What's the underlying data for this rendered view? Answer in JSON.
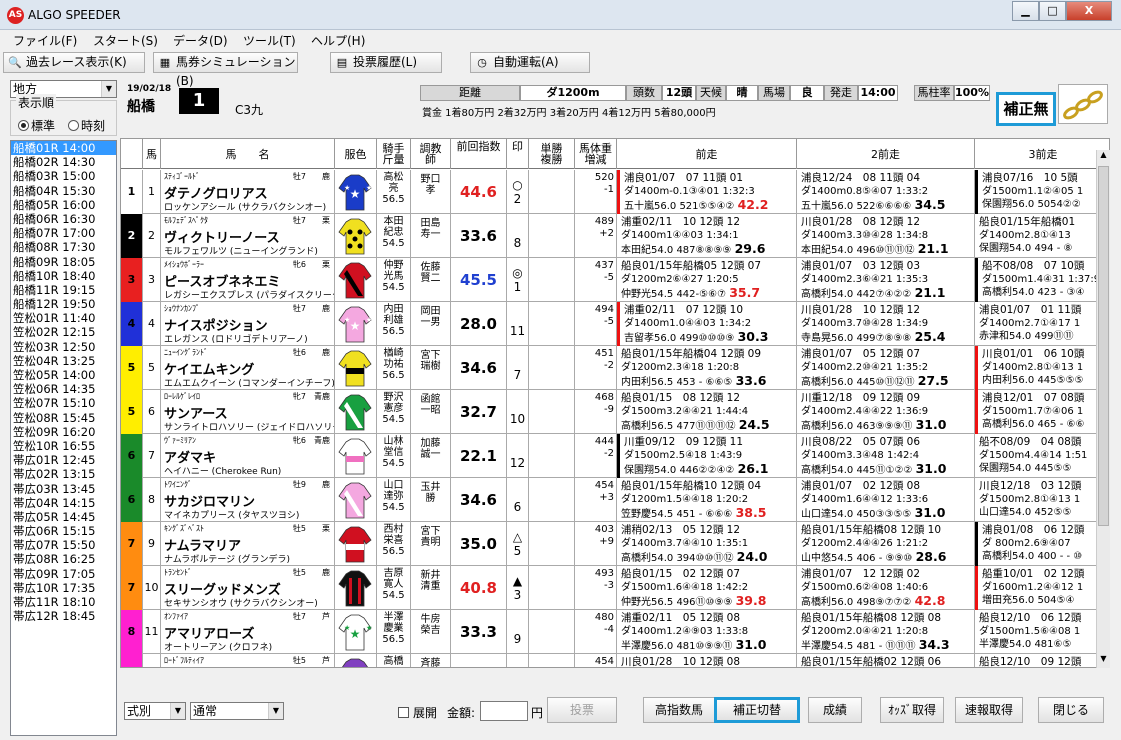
{
  "window": {
    "title": "ALGO SPEEDER",
    "app_icon": "AS",
    "minimize_label": "▁",
    "maximize_label": "□",
    "close_label": "X"
  },
  "menu": [
    "ファイル(F)",
    "スタート(S)",
    "データ(D)",
    "ツール(T)",
    "ヘルプ(H)"
  ],
  "toolbar": {
    "past_races": "過去レース表示(K)",
    "betting_sim": "馬券シミュレーション(B)",
    "bet_history": "投票履歴(L)",
    "auto_run": "自動運転(A)"
  },
  "left": {
    "region": "地方",
    "order_label": "表示順",
    "order_standard": "標準",
    "order_time": "時刻",
    "races": [
      "船橋01R 14:00",
      "船橋02R 14:30",
      "船橋03R 15:00",
      "船橋04R 15:30",
      "船橋05R 16:00",
      "船橋06R 16:30",
      "船橋07R 17:00",
      "船橋08R 17:30",
      "船橋09R 18:05",
      "船橋10R 18:40",
      "船橋11R 19:15",
      "船橋12R 19:50",
      "笠松01R 11:40",
      "笠松02R 12:15",
      "笠松03R 12:50",
      "笠松04R 13:25",
      "笠松05R 14:00",
      "笠松06R 14:35",
      "笠松07R 15:10",
      "笠松08R 15:45",
      "笠松09R 16:20",
      "笠松10R 16:55",
      "帯広01R 12:45",
      "帯広02R 13:15",
      "帯広03R 13:45",
      "帯広04R 14:15",
      "帯広05R 14:45",
      "帯広06R 15:15",
      "帯広07R 15:50",
      "帯広08R 16:25",
      "帯広09R 17:05",
      "帯広10R 17:35",
      "帯広11R 18:10",
      "帯広12R 18:45"
    ]
  },
  "race": {
    "date": "19/02/18",
    "track": "船橋",
    "number": "1",
    "class": "C3九",
    "dist_label": "距離",
    "dist": "ダ1200m",
    "heads_label": "頭数",
    "heads": "12頭",
    "weather_label": "天候",
    "weather": "晴",
    "going_label": "馬場",
    "going": "良",
    "post_label": "発走",
    "post": "14:00",
    "pillar_label": "馬柱率",
    "pillar": "100%",
    "prize": "賞金 1着80万円  2着32万円  3着20万円  4着12万円  5着80,000円"
  },
  "hosei": "補正無",
  "header": {
    "uma": "馬",
    "name": "馬　　名",
    "fuku": "服色",
    "jockey": "騎手\n斤量",
    "trainer": "調教\n師",
    "index": "前回指数",
    "mark": "印",
    "odds": "単勝\n複勝",
    "weight": "馬体重\n増減",
    "prev1": "前走",
    "prev2": "2前走",
    "prev3": "3前走"
  },
  "horses": [
    {
      "waku": "1",
      "waku_color": "#ffffff",
      "waku_text": "#000",
      "uma": "1",
      "sire": "ｽﾃｨｺﾞｰﾙﾄﾞ",
      "sexage": "牡7",
      "stable": "鹿",
      "name": "ダテノグロリアス",
      "dam": "ロッケンアシール (サクラバクシンオー)",
      "jockey": "高松\n亮\n56.5",
      "trainer": "野口\n孝",
      "index": "44.6",
      "idx_color": "#e02020",
      "mark": "○\n2",
      "weight": "520\n-1",
      "p1": [
        "浦良01/07　07 11頭 01",
        "ダ1400m-0.1③④01 1:32:3",
        "五十嵐56.0 521⑤⑤④② 42.2"
      ],
      "p1bar": "r",
      "p2": [
        "浦良12/24　08 11頭 04",
        "ダ1400m0.8⑤④07 1:33:2",
        "五十嵐56.0 522⑥⑥⑥⑥ 34.5"
      ],
      "p2bar": "",
      "p3": [
        "浦良07/16　10 5頭",
        "ダ1500m1.1②④05 1",
        "保園翔56.0 5054②②"
      ],
      "p3bar": "k",
      "silk": "blue-star"
    },
    {
      "waku": "2",
      "waku_color": "#000000",
      "waku_text": "#fff",
      "uma": "2",
      "sire": "ﾓﾙﾌｪﾃﾞｽﾍﾟｸﾀ",
      "sexage": "牡7",
      "stable": "栗",
      "name": "ヴィクトリーノース",
      "dam": "モルフェワルツ (ニューイングランド)",
      "jockey": "本田\n紀忠\n54.5",
      "trainer": "田島\n寿一",
      "index": "33.6",
      "idx_color": "#000",
      "mark": "\n8",
      "weight": "489\n+2",
      "p1": [
        "浦重02/11　10 12頭 12",
        "ダ1400m1④④03 1:34:1",
        "本田紀54.0 487⑧⑧⑨⑨ 29.6"
      ],
      "p1bar": "",
      "p2": [
        "川良01/28　08 12頭 12",
        "ダ1400m3.3⑩④28 1:34:8",
        "本田紀54.0 496⑩⑪⑪⑫ 21.1"
      ],
      "p2bar": "",
      "p3": [
        "船良01/15年船橋01",
        "ダ1400m2.8①④13",
        "保園翔54.0 494 - ⑧"
      ],
      "p3bar": "",
      "silk": "yellow-dots"
    },
    {
      "waku": "3",
      "waku_color": "#e82020",
      "waku_text": "#000",
      "uma": "3",
      "sire": "ﾒｲｼｮｳﾎﾞｰﾗｰ",
      "sexage": "牝6",
      "stable": "栗",
      "name": "ピースオブネネエミ",
      "dam": "レガシーエクスプレス (パラダイスクリーク)",
      "jockey": "仲野\n光馬\n54.5",
      "trainer": "佐藤\n賢二",
      "index": "45.5",
      "idx_color": "#2040d0",
      "mark": "◎\n1",
      "weight": "437\n-5",
      "p1": [
        "船良01/15年船橋05 12頭 07",
        "ダ1200m2⑥④27 1:20:5",
        "仲野光54.5 442-⑤⑥⑦ 35.7"
      ],
      "p1bar": "",
      "p2": [
        "浦良01/07　03 12頭 03",
        "ダ1400m2.3⑥④21 1:35:3",
        "高橋利54.0 442⑦④②② 21.1"
      ],
      "p2bar": "",
      "p3": [
        "船不08/08　07 10頭",
        "ダ1500m1.4④31 1:37:9",
        "高橋利54.0 423 - ③④"
      ],
      "p3bar": "k",
      "silk": "red-black"
    },
    {
      "waku": "4",
      "waku_color": "#2030d8",
      "waku_text": "#000",
      "uma": "4",
      "sire": "ｼｮｳﾅﾝｶﾝﾌﾟ",
      "sexage": "牡7",
      "stable": "鹿",
      "name": "ナイスポジション",
      "dam": "エレガンス (ロドリゴデトリアーノ)",
      "jockey": "内田\n利雄\n56.5",
      "trainer": "岡田\n一男",
      "index": "28.0",
      "idx_color": "#000",
      "mark": "\n11",
      "weight": "494\n-5",
      "p1": [
        "浦重02/11　07 12頭 10",
        "ダ1400m1.0④④03 1:34:2",
        "吉留孝56.0 499⑩⑩⑩⑨ 30.3"
      ],
      "p1bar": "r",
      "p2": [
        "川良01/28　10 12頭 12",
        "ダ1400m3.7⑩④28 1:34:9",
        "寺島晃56.0 499⑦⑧⑨⑧ 25.4"
      ],
      "p2bar": "",
      "p3": [
        "浦良01/07　01 11頭",
        "ダ1400m2.7①④17 1",
        "赤津和54.0 499⑪⑪"
      ],
      "p3bar": "",
      "silk": "pink-stars"
    },
    {
      "waku": "5",
      "waku_color": "#ffee00",
      "waku_text": "#000",
      "uma": "5",
      "sire": "ﾆｭｰｲﾝｸﾞﾗﾝﾄﾞ",
      "sexage": "牡6",
      "stable": "鹿",
      "name": "ケイエムキング",
      "dam": "エムエムクイーン (コマンダーインチーフ)",
      "jockey": "楢崎\n功祐\n56.5",
      "trainer": "宮下\n瑞樹",
      "index": "34.6",
      "idx_color": "#000",
      "mark": "\n7",
      "weight": "451\n-2",
      "p1": [
        "船良01/15年船橋04 12頭 09",
        "ダ1200m2.3④18 1:20:8",
        "内田利56.5 453 - ⑥⑥⑤ 33.6"
      ],
      "p1bar": "",
      "p2": [
        "浦良01/07　05 12頭 07",
        "ダ1400m2.2⑩④21 1:35:2",
        "高橋利56.0 445⑩⑪⑫⑪ 27.5"
      ],
      "p2bar": "",
      "p3": [
        "川良01/01　06 10頭",
        "ダ1400m2.8①④13 1",
        "内田利56.0 445⑤⑤⑤"
      ],
      "p3bar": "r",
      "silk": "yellow-black"
    },
    {
      "waku": "5",
      "waku_color": "#ffee00",
      "waku_text": "#000",
      "uma": "6",
      "sire": "ﾛｰﾚﾙｹﾞﾚｲﾛ",
      "sexage": "牝7",
      "stable": "青鹿",
      "name": "サンアース",
      "dam": "サンライトロハソリー (ジェイドロハソリー)",
      "jockey": "野沢\n憲彦\n54.5",
      "trainer": "函館\n一昭",
      "index": "32.7",
      "idx_color": "#000",
      "mark": "\n10",
      "weight": "468\n-9",
      "p1": [
        "船良01/15　08 12頭 12",
        "ダ1500m3.2④④21 1:44:4",
        "高橋利56.5 477⑪⑪⑪⑫ 24.5"
      ],
      "p1bar": "",
      "p2": [
        "川重12/18　09 12頭 09",
        "ダ1400m2.4④④22 1:36:9",
        "高橋利56.0 463⑨⑨⑨⑪ 31.0"
      ],
      "p2bar": "",
      "p3": [
        "浦良12/01　07 08頭",
        "ダ1500m1.7⑦④06 1",
        "高橋利56.0 465 - ⑥⑥"
      ],
      "p3bar": "r",
      "silk": "green-white"
    },
    {
      "waku": "6",
      "waku_color": "#1a8a2a",
      "waku_text": "#000",
      "uma": "7",
      "sire": "ｳﾞｧｰﾐﾘｱﾝ",
      "sexage": "牝6",
      "stable": "青鹿",
      "name": "アダマキ",
      "dam": "ヘイハニー (Cherokee Run)",
      "jockey": "山林\n堂信\n54.5",
      "trainer": "加藤\n誠一",
      "index": "22.1",
      "idx_color": "#000",
      "mark": "\n12",
      "weight": "444\n-2",
      "p1": [
        "川重09/12　09 12頭 11",
        "ダ1500m2.5④18 1:43:9",
        "保園翔54.0 446②②④② 26.1"
      ],
      "p1bar": "k",
      "p2": [
        "川良08/22　05 07頭 06",
        "ダ1400m3.3④48 1:42:4",
        "高橋利54.0 445⑪①②② 31.0"
      ],
      "p2bar": "",
      "p3": [
        "船不08/09　04 08頭",
        "ダ1500m4.4④14 1:51",
        "保園翔54.0 445⑤⑤"
      ],
      "p3bar": "",
      "silk": "white-pink"
    },
    {
      "waku": "6",
      "waku_color": "#1a8a2a",
      "waku_text": "#000",
      "uma": "8",
      "sire": "ﾄﾜｲﾆﾝｸﾞ",
      "sexage": "牡9",
      "stable": "鹿",
      "name": "サカジロマリン",
      "dam": "マイネカプリース (タヤスツヨシ)",
      "jockey": "山口\n達弥\n54.5",
      "trainer": "玉井\n勝",
      "index": "34.6",
      "idx_color": "#000",
      "mark": "\n6",
      "weight": "454\n+3",
      "p1": [
        "船良01/15年船橋10 12頭 04",
        "ダ1200m1.5④④18 1:20:2",
        "笠野慶54.5 451 - ⑥⑥⑥ 38.5"
      ],
      "p1bar": "",
      "p2": [
        "浦良01/07　02 12頭 08",
        "ダ1400m1.6④④12 1:33:6",
        "山口達54.0 450③③⑤⑤ 31.0"
      ],
      "p2bar": "",
      "p3": [
        "川良12/18　03 12頭",
        "ダ1500m2.8①④13 1",
        "山口達54.0 452⑤⑤"
      ],
      "p3bar": "",
      "silk": "pink-white"
    },
    {
      "waku": "7",
      "waku_color": "#ff8c10",
      "waku_text": "#000",
      "uma": "9",
      "sire": "ｷﾝｸﾞｽﾞﾍﾞｽﾄ",
      "sexage": "牡5",
      "stable": "栗",
      "name": "ナムラマリア",
      "dam": "ナムラボルテージ (グランデラ)",
      "jockey": "西村\n栄喜\n56.5",
      "trainer": "宮下\n貴明",
      "index": "35.0",
      "idx_color": "#000",
      "mark": "△\n5",
      "weight": "403\n+9",
      "p1": [
        "浦稍02/13　05 12頭 12",
        "ダ1400m3.7④④10 1:35:1",
        "高橋利54.0 394⑩⑩⑪⑫ 24.0"
      ],
      "p1bar": "",
      "p2": [
        "船良01/15年船橋08 12頭 10",
        "ダ1200m2.4④④26 1:21:2",
        "山中悠54.5 406 - ⑨⑨⑩ 28.6"
      ],
      "p2bar": "",
      "p3": [
        "浦良01/08　06 12頭",
        "ダ 800m2.6⑨④07",
        "高橋利54.0 400 - - ⑩"
      ],
      "p3bar": "k",
      "silk": "red-white"
    },
    {
      "waku": "7",
      "waku_color": "#ff8c10",
      "waku_text": "#000",
      "uma": "10",
      "sire": "ﾄﾗﾝｾﾝﾄﾞ",
      "sexage": "牡5",
      "stable": "鹿",
      "name": "スリーグッドメンズ",
      "dam": "セキサンシオウ (サクラバクシンオー)",
      "jockey": "吉原\n寛人\n54.5",
      "trainer": "新井\n清重",
      "index": "40.8",
      "idx_color": "#e02020",
      "mark": "▲\n3",
      "weight": "493\n-3",
      "p1": [
        "船良01/15　02 12頭 07",
        "ダ1500m1.6④④18 1:42:2",
        "仲野光56.5 496⑪⑩⑨⑨ 39.8"
      ],
      "p1bar": "",
      "p2": [
        "浦良01/07　12 12頭 02",
        "ダ1500m0.6②④08 1:40:6",
        "高橋利56.0 498⑨⑦⑦② 42.8"
      ],
      "p2bar": "",
      "p3": [
        "船重10/01　02 12頭",
        "ダ1600m1.2④④12 1",
        "増田充56.0 504⑤④"
      ],
      "p3bar": "r",
      "silk": "black-red"
    },
    {
      "waku": "8",
      "waku_color": "#ff20d0",
      "waku_text": "#000",
      "uma": "11",
      "sire": "ｵﾝﾌｧｲｱ",
      "sexage": "牡7",
      "stable": "芦",
      "name": "アマリアローズ",
      "dam": "オートリーアン (クロフネ)",
      "jockey": "半澤\n慶業\n56.5",
      "trainer": "牛房\n榮吉",
      "index": "33.3",
      "idx_color": "#000",
      "mark": "\n9",
      "weight": "480\n-4",
      "p1": [
        "浦重02/11　05 12頭 08",
        "ダ1400m1.2④⑨03 1:33:8",
        "半澤慶56.0 481⑩⑨⑨⑪ 31.0"
      ],
      "p1bar": "",
      "p2": [
        "船良01/15年船橋08 12頭 08",
        "ダ1200m2.0④④21 1:20:8",
        "半澤慶54.5 481 - ⑪⑪⑪ 34.3"
      ],
      "p2bar": "",
      "p3": [
        "船良12/10　06 12頭",
        "ダ1500m1.5⑥④08 1",
        "半澤慶54.0 481⑥⑤"
      ],
      "p3bar": "",
      "silk": "white-green"
    },
    {
      "waku": "8",
      "waku_color": "#ff20d0",
      "waku_text": "#000",
      "uma": "12",
      "sire": "ﾛｰﾄﾞﾌﾙﾃｨｲｱ",
      "sexage": "牡5",
      "stable": "芦",
      "name": "",
      "dam": "",
      "jockey": "高橋",
      "trainer": "斉藤",
      "index": "",
      "idx_color": "#000",
      "mark": "",
      "weight": "454",
      "p1": [
        "川良01/28　10 12頭 08",
        "",
        ""
      ],
      "p1bar": "",
      "p2": [
        "船良01/15年船橋02 12頭 06",
        "",
        ""
      ],
      "p2bar": "",
      "p3": [
        "船良12/10　09 12頭",
        "",
        ""
      ],
      "p3bar": "",
      "silk": "purple"
    }
  ],
  "bottom": {
    "bet_type": "式別",
    "mode": "通常",
    "expand": "展開",
    "amount_label": "金額:",
    "amount_unit": "円",
    "vote": "投票",
    "high_index": "高指数馬",
    "hosei_switch": "補正切替",
    "results": "成績",
    "odds": "ｵｯｽﾞ取得",
    "quick": "速報取得",
    "close": "閉じる"
  }
}
